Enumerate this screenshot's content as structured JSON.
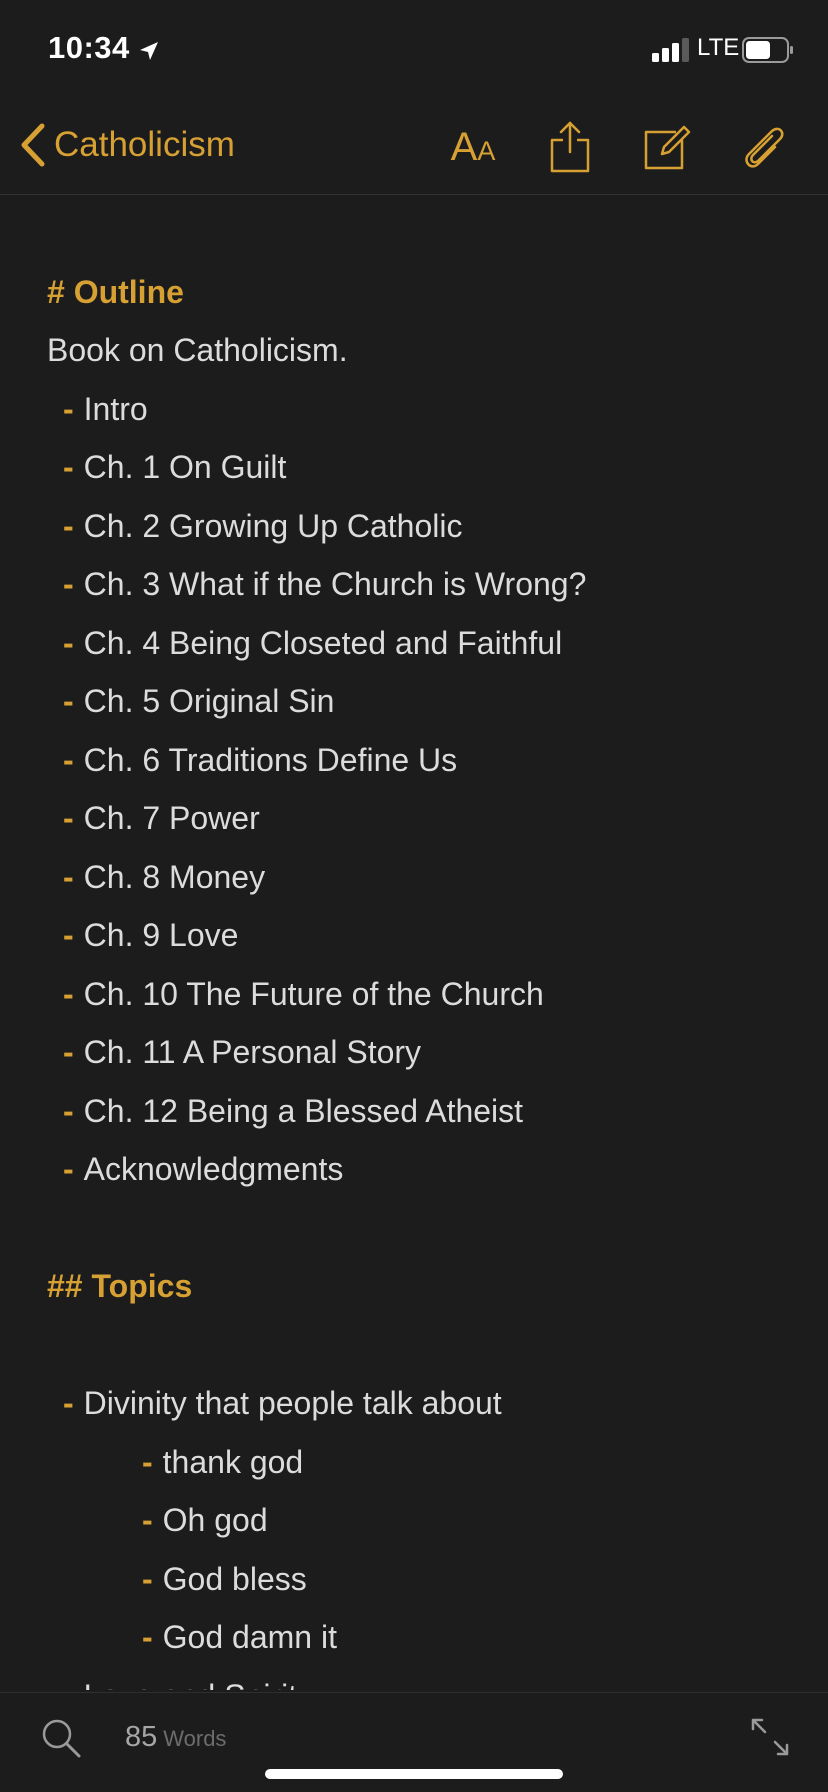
{
  "status_bar": {
    "time": "10:34",
    "network": "LTE",
    "location_icon": "location-arrow-icon",
    "signal_icon": "signal-bars-icon",
    "battery_icon": "battery-icon"
  },
  "nav_bar": {
    "back_label": "Catholicism",
    "back_icon": "chevron-left-icon",
    "font_icon_big": "A",
    "font_icon_small": "A",
    "actions": [
      "font-size-icon",
      "share-icon",
      "compose-icon",
      "paperclip-icon"
    ]
  },
  "editor": {
    "outline_heading": "# Outline",
    "intro_text": "Book on Catholicism.",
    "outline_items": [
      "Intro",
      "Ch. 1 On Guilt",
      "Ch. 2 Growing Up Catholic",
      "Ch. 3 What if the Church is Wrong?",
      "Ch. 4 Being Closeted and Faithful",
      "Ch. 5 Original Sin",
      "Ch. 6 Traditions Define Us",
      "Ch. 7 Power",
      "Ch. 8 Money",
      "Ch. 9 Love",
      "Ch. 10 The Future of the Church",
      "Ch. 11 A Personal Story",
      "Ch. 12 Being a Blessed Atheist",
      "Acknowledgments"
    ],
    "topics_heading": "## Topics",
    "topics": [
      {
        "label": "Divinity that people talk about",
        "children": [
          "thank god",
          "Oh god",
          "God bless",
          "God damn it"
        ]
      },
      {
        "label": "Love and Spirit",
        "children": []
      }
    ],
    "dash": "-",
    "accent_color": "#d7a032"
  },
  "bottom_bar": {
    "word_count": "85",
    "word_count_label": "Words",
    "search_icon": "search-icon",
    "expand_icon": "expand-arrows-icon"
  }
}
